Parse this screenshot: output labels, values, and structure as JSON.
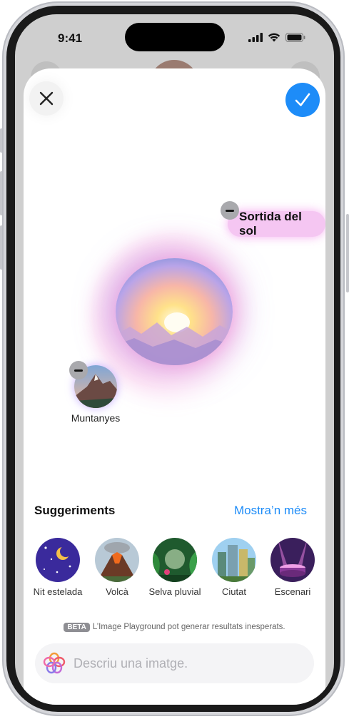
{
  "status_bar": {
    "time": "9:41"
  },
  "header": {
    "close_icon": "close-icon",
    "confirm_icon": "checkmark-icon"
  },
  "concepts": {
    "sunrise_label": "Sortida del sol",
    "mountains_label": "Muntanyes"
  },
  "suggestions": {
    "title": "Suggeriments",
    "more_label": "Mostra’n més",
    "items": [
      {
        "label": "Nit estelada"
      },
      {
        "label": "Volcà"
      },
      {
        "label": "Selva pluvial"
      },
      {
        "label": "Ciutat"
      },
      {
        "label": "Escenari"
      }
    ]
  },
  "disclaimer": {
    "badge": "BETA",
    "text": "L’Image Playground pot generar resultats inesperats."
  },
  "prompt": {
    "placeholder": "Descriu una imatge."
  },
  "colors": {
    "accent": "#1d8cf8",
    "chip_pink": "#f5c6f2"
  }
}
